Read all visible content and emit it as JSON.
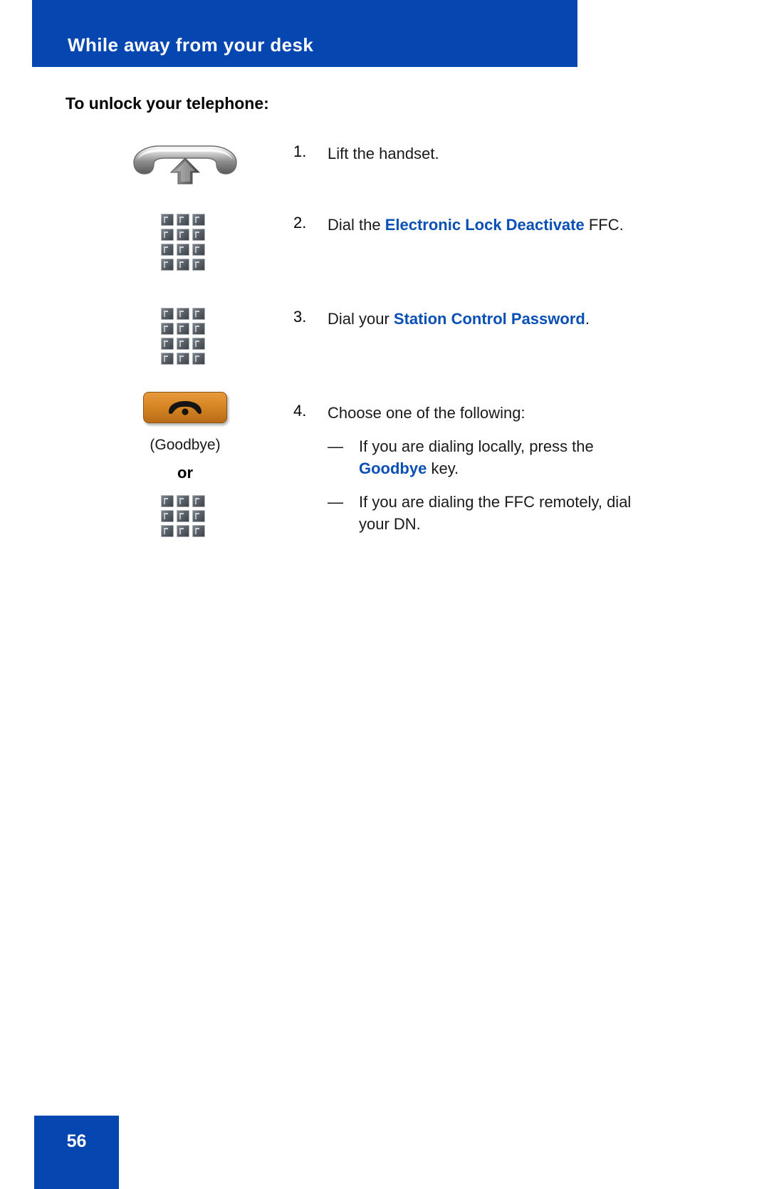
{
  "header": {
    "title": "While away from your desk",
    "band_color": "#0646B1"
  },
  "section": {
    "heading": "To unlock your telephone:"
  },
  "colors": {
    "accent_blue": "#0646B1",
    "link_blue": "#0A4FB5",
    "goodbye_orange": "#d88624",
    "keypad_gray": "#5b6369"
  },
  "steps": [
    {
      "number": "1.",
      "icon": "lift-handset-icon",
      "text_parts": [
        {
          "text": "Lift the handset.",
          "style": "normal"
        }
      ]
    },
    {
      "number": "2.",
      "icon": "keypad-icon",
      "text_parts": [
        {
          "text": "Dial the ",
          "style": "normal"
        },
        {
          "text": "Electronic Lock Deactivate",
          "style": "highlight"
        },
        {
          "text": " FFC.",
          "style": "normal"
        }
      ]
    },
    {
      "number": "3.",
      "icon": "keypad-icon",
      "text_parts": [
        {
          "text": "Dial your ",
          "style": "normal"
        },
        {
          "text": "Station Control Password",
          "style": "highlight"
        },
        {
          "text": ".",
          "style": "normal"
        }
      ]
    },
    {
      "number": "4.",
      "icon": "goodbye-button-icon",
      "text_parts": [
        {
          "text": "Choose one of the following:",
          "style": "normal"
        }
      ],
      "icon_label": "(Goodbye)",
      "or_label": "or",
      "second_icon": "keypad-icon",
      "subitems": [
        {
          "dash": "—",
          "parts": [
            {
              "text": "If you are dialing locally, press the ",
              "style": "normal"
            },
            {
              "text": "Goodbye",
              "style": "highlight"
            },
            {
              "text": " key.",
              "style": "normal"
            }
          ]
        },
        {
          "dash": "—",
          "parts": [
            {
              "text": "If you are dialing the FFC remotely, dial your DN.",
              "style": "normal"
            }
          ]
        }
      ]
    }
  ],
  "footer": {
    "page_number": "56"
  }
}
